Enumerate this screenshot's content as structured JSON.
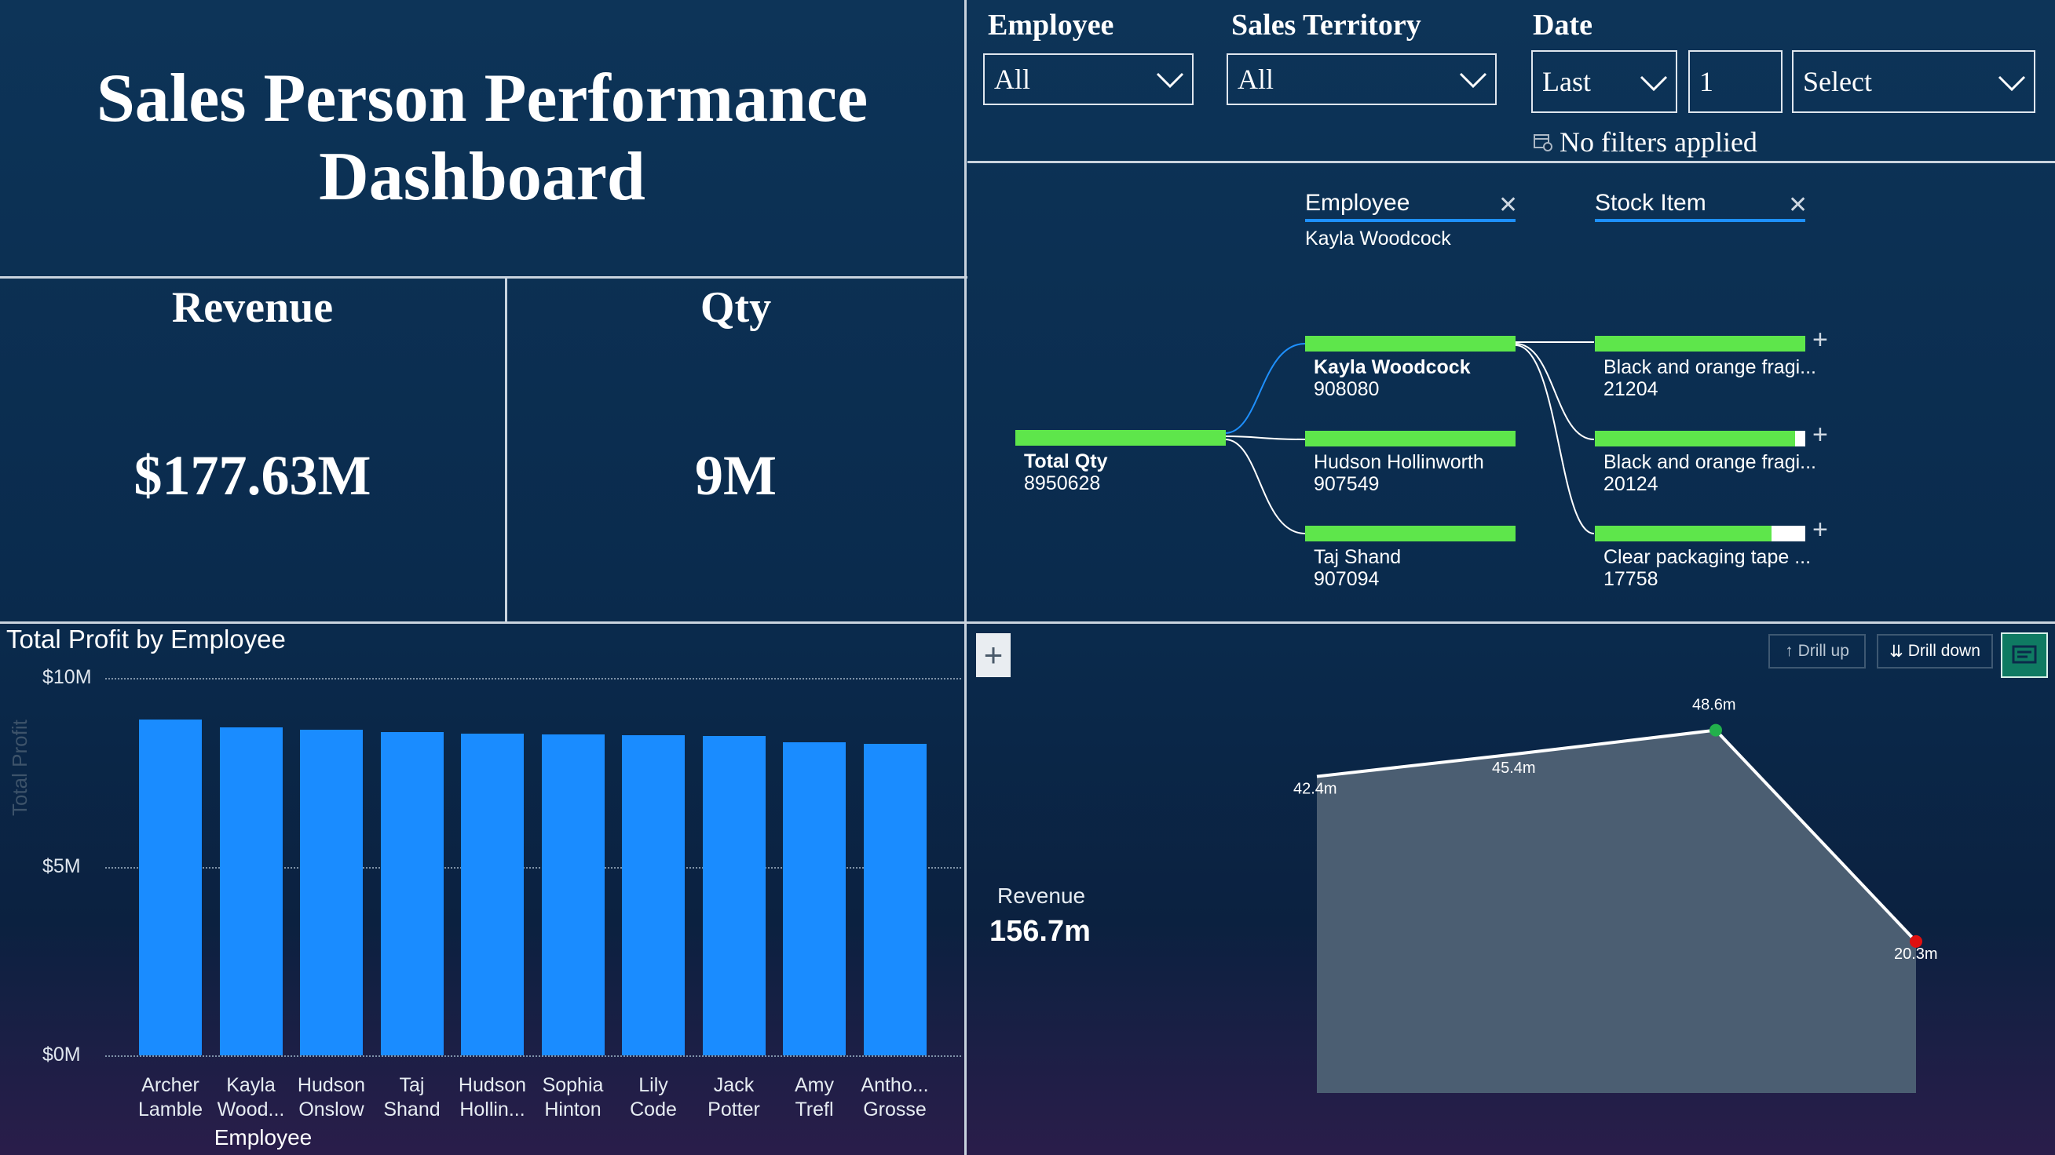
{
  "title": "Sales Person Performance Dashboard",
  "kpis": {
    "revenue": {
      "label": "Revenue",
      "value": "$177.63M"
    },
    "qty": {
      "label": "Qty",
      "value": "9M"
    }
  },
  "slicers": {
    "employee": {
      "label": "Employee",
      "value": "All"
    },
    "territory": {
      "label": "Sales Territory",
      "value": "All"
    },
    "date": {
      "label": "Date",
      "period": "Last",
      "count": "1",
      "unit": "Select",
      "status": "No filters applied"
    }
  },
  "decomp_tree": {
    "headers": [
      {
        "label": "Employee",
        "value": "Kayla Woodcock"
      },
      {
        "label": "Stock Item",
        "value": ""
      }
    ],
    "root": {
      "name": "Total Qty",
      "value": "8950628"
    },
    "level1": [
      {
        "name": "Kayla Woodcock",
        "value": "908080",
        "fill": 1.0
      },
      {
        "name": "Hudson Hollinworth",
        "value": "907549",
        "fill": 0.999
      },
      {
        "name": "Taj Shand",
        "value": "907094",
        "fill": 0.999
      }
    ],
    "level2": [
      {
        "name": "Black and orange fragi...",
        "value": "21204",
        "fill": 1.0
      },
      {
        "name": "Black and orange fragi...",
        "value": "20124",
        "fill": 0.95
      },
      {
        "name": "Clear packaging tape ...",
        "value": "17758",
        "fill": 0.84
      }
    ]
  },
  "chart_data": [
    {
      "type": "bar",
      "title": "Total Profit by Employee",
      "xlabel": "Employee",
      "ylabel": "Total Profit",
      "ylim": [
        0,
        10000000
      ],
      "yticks": [
        "$10M",
        "$5M",
        "$0M"
      ],
      "categories": [
        [
          "Archer",
          "Lamble"
        ],
        [
          "Kayla",
          "Wood..."
        ],
        [
          "Hudson",
          "Onslow"
        ],
        [
          "Taj",
          "Shand"
        ],
        [
          "Hudson",
          "Hollin..."
        ],
        [
          "Sophia",
          "Hinton"
        ],
        [
          "Lily",
          "Code"
        ],
        [
          "Jack",
          "Potter"
        ],
        [
          "Amy",
          "Trefl"
        ],
        [
          "Antho...",
          "Grosse"
        ]
      ],
      "values": [
        8900000,
        8680000,
        8620000,
        8560000,
        8520000,
        8500000,
        8490000,
        8470000,
        8300000,
        8250000
      ]
    },
    {
      "type": "area",
      "label": "Revenue",
      "total": "156.7m",
      "points": [
        {
          "y": 42.4,
          "label": "42.4m"
        },
        {
          "y": 45.4,
          "label": "45.4m"
        },
        {
          "y": 48.6,
          "label": "48.6m",
          "marker": "#22b14c"
        },
        {
          "y": 20.3,
          "label": "20.3m",
          "marker": "#e01010"
        }
      ]
    }
  ],
  "toolbar": {
    "drill_up": "Drill up",
    "drill_down": "Drill down"
  },
  "icons": {
    "chevron": "chevron-down-icon",
    "calendar": "calendar-clock-icon",
    "close": "close-icon",
    "plus": "plus-icon"
  }
}
